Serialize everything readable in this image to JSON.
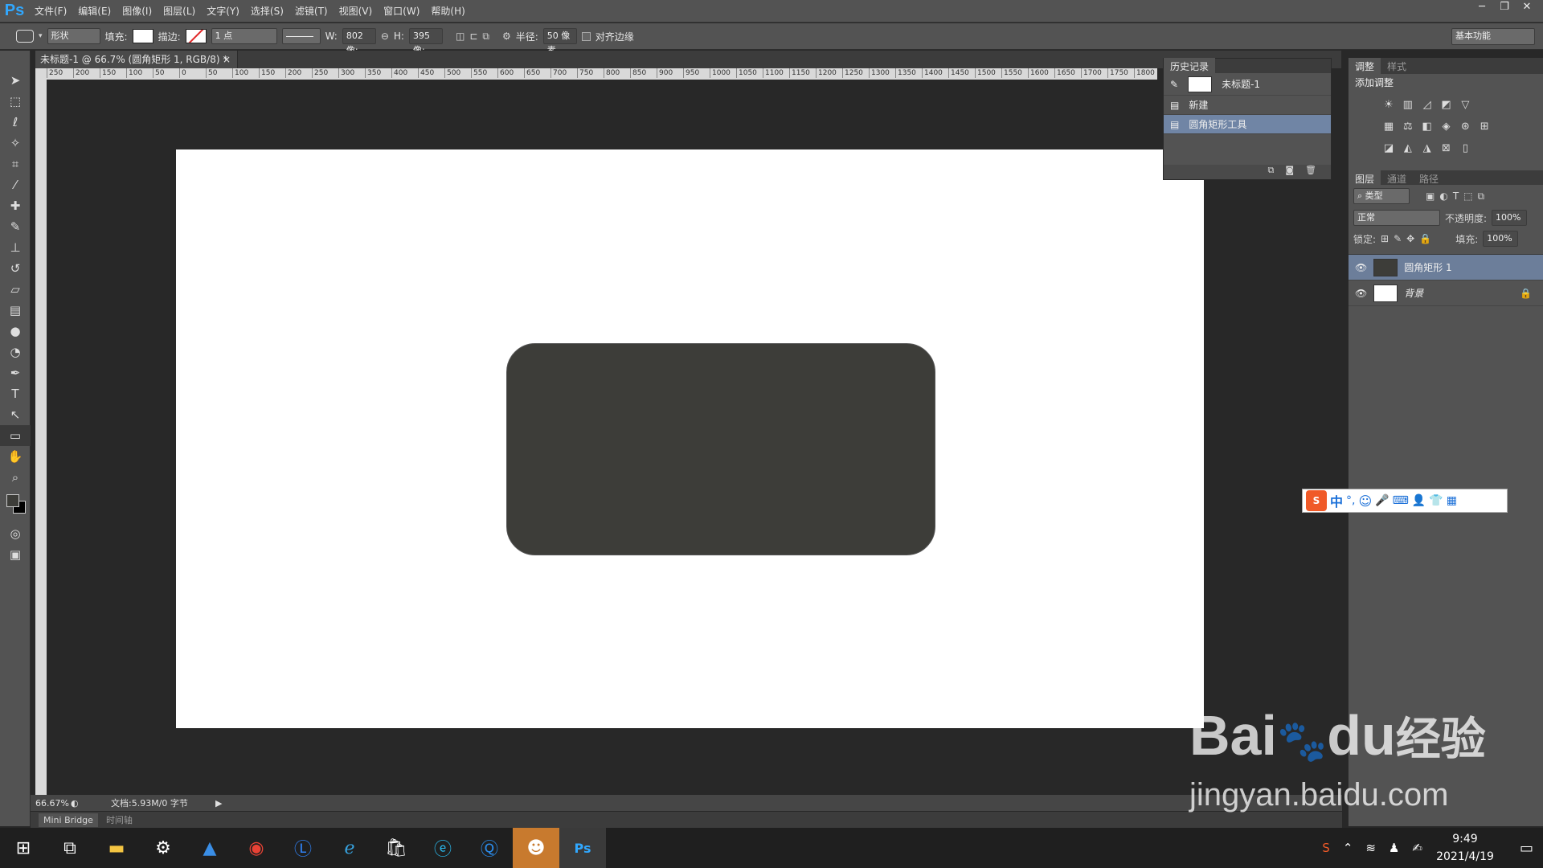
{
  "app": {
    "logo": "Ps"
  },
  "menu": [
    "文件(F)",
    "编辑(E)",
    "图像(I)",
    "图层(L)",
    "文字(Y)",
    "选择(S)",
    "滤镜(T)",
    "视图(V)",
    "窗口(W)",
    "帮助(H)"
  ],
  "options": {
    "mode": "形状",
    "fill_label": "填充:",
    "stroke_label": "描边:",
    "stroke_size": "1 点",
    "w_label": "W:",
    "w_value": "802 像:",
    "h_label": "H:",
    "h_value": "395 像:",
    "radius_label": "半径:",
    "radius_value": "50 像素",
    "align_edges": "对齐边缘",
    "workspace": "基本功能"
  },
  "document": {
    "tab": "未标题-1 @ 66.7% (圆角矩形 1, RGB/8) *",
    "zoom": "66.67%",
    "doc_info": "文档:5.93M/0 字节"
  },
  "ruler_ticks": [
    "250",
    "200",
    "150",
    "100",
    "50",
    "0",
    "50",
    "100",
    "150",
    "200",
    "250",
    "300",
    "350",
    "400",
    "450",
    "500",
    "550",
    "600",
    "650",
    "700",
    "750",
    "800",
    "850",
    "900",
    "950",
    "1000",
    "1050",
    "1100",
    "1150",
    "1200",
    "1250",
    "1300",
    "1350",
    "1400",
    "1450",
    "1500",
    "1550",
    "1600",
    "1650",
    "1700",
    "1750",
    "1800"
  ],
  "bottom_tabs": [
    "Mini Bridge",
    "时间轴"
  ],
  "history": {
    "title": "历史记录",
    "snapshot": "未标题-1",
    "items": [
      "新建",
      "圆角矩形工具"
    ]
  },
  "adjustments": {
    "tabs": [
      "调整",
      "样式"
    ],
    "title": "添加调整"
  },
  "layers": {
    "tabs": [
      "图层",
      "通道",
      "路径"
    ],
    "filter": "类型",
    "blend": "正常",
    "opacity_label": "不透明度:",
    "opacity": "100%",
    "lock_label": "锁定:",
    "fill_label": "填充:",
    "fill": "100%",
    "items": [
      {
        "name": "圆角矩形 1"
      },
      {
        "name": "背景"
      }
    ]
  },
  "ime": {
    "items": [
      "中",
      "°,"
    ]
  },
  "taskbar": {
    "time": "9:49",
    "date": "2021/4/19"
  },
  "watermark": {
    "brand": "Bai",
    "brand2": "du",
    "cn": "经验",
    "url": "jingyan.baidu.com"
  },
  "colors": {
    "accent": "#31a8ff",
    "selection": "#7085a5",
    "shape": "#3d3d39"
  }
}
